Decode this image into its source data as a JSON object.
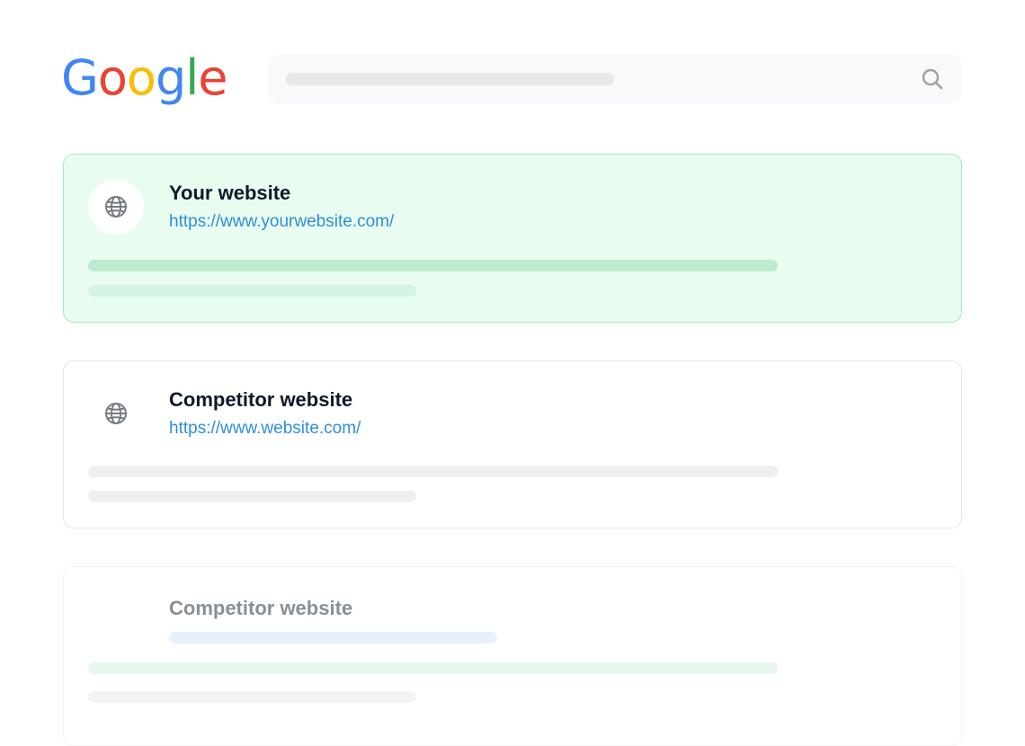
{
  "logo": {
    "letters": [
      "G",
      "o",
      "o",
      "g",
      "l",
      "e"
    ],
    "colors": [
      "#4285F4",
      "#EA4335",
      "#FBBC05",
      "#4285F4",
      "#34A853",
      "#EA4335"
    ]
  },
  "search": {
    "icon": "search-icon"
  },
  "results": [
    {
      "title": "Your website",
      "url": "https://www.yourwebsite.com/",
      "icon": "globe-icon",
      "highlighted": true
    },
    {
      "title": "Competitor website",
      "url": "https://www.website.com/",
      "icon": "globe-icon",
      "highlighted": false
    },
    {
      "title": "Competitor website",
      "url": "",
      "icon": "",
      "highlighted": false
    }
  ],
  "colors": {
    "highlight_bg": "#e8fcf0",
    "highlight_border": "#a8e9c0",
    "link": "#2d8fd8",
    "title": "#111827"
  }
}
